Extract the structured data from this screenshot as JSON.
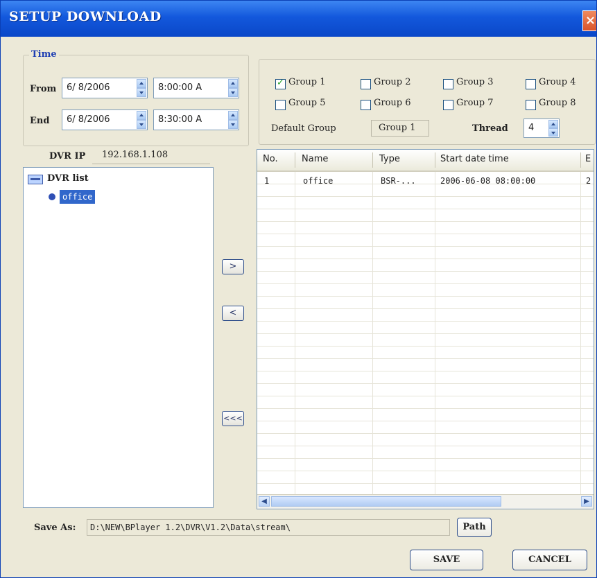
{
  "window": {
    "title": "SETUP DOWNLOAD",
    "close_glyph": "×"
  },
  "time": {
    "legend": "Time",
    "from_label": "From",
    "from_date": "6/ 8/2006",
    "from_time": "8:00:00 A",
    "end_label": "End",
    "end_date": "6/ 8/2006",
    "end_time": "8:30:00 A"
  },
  "groups": [
    {
      "label": "Group 1",
      "checked": true
    },
    {
      "label": "Group 2",
      "checked": false
    },
    {
      "label": "Group 3",
      "checked": false
    },
    {
      "label": "Group 4",
      "checked": false
    },
    {
      "label": "Group 5",
      "checked": false
    },
    {
      "label": "Group 6",
      "checked": false
    },
    {
      "label": "Group 7",
      "checked": false
    },
    {
      "label": "Group 8",
      "checked": false
    }
  ],
  "default_group": {
    "label": "Default Group",
    "value": "Group 1"
  },
  "thread": {
    "label": "Thread",
    "value": "4"
  },
  "dvr": {
    "ip_label": "DVR IP",
    "ip_value": "192.168.1.108"
  },
  "tree": {
    "root": "DVR list",
    "child": "office",
    "root_icon": "dvr-list-icon",
    "child_icon": "dvr-node-icon"
  },
  "buttons": {
    "add": ">",
    "remove": "<",
    "remove_all": "<<<",
    "path": "Path",
    "save": "SAVE",
    "cancel": "CANCEL"
  },
  "table": {
    "columns": [
      "No.",
      "Name",
      "Type",
      "Start date time",
      "E"
    ],
    "rows": [
      [
        "1",
        "office",
        "BSR-...",
        "2006-06-08 08:00:00",
        "2"
      ]
    ]
  },
  "save_as": {
    "label": "Save As:",
    "path": "D:\\NEW\\BPlayer 1.2\\DVR\\V1.2\\Data\\stream\\"
  }
}
